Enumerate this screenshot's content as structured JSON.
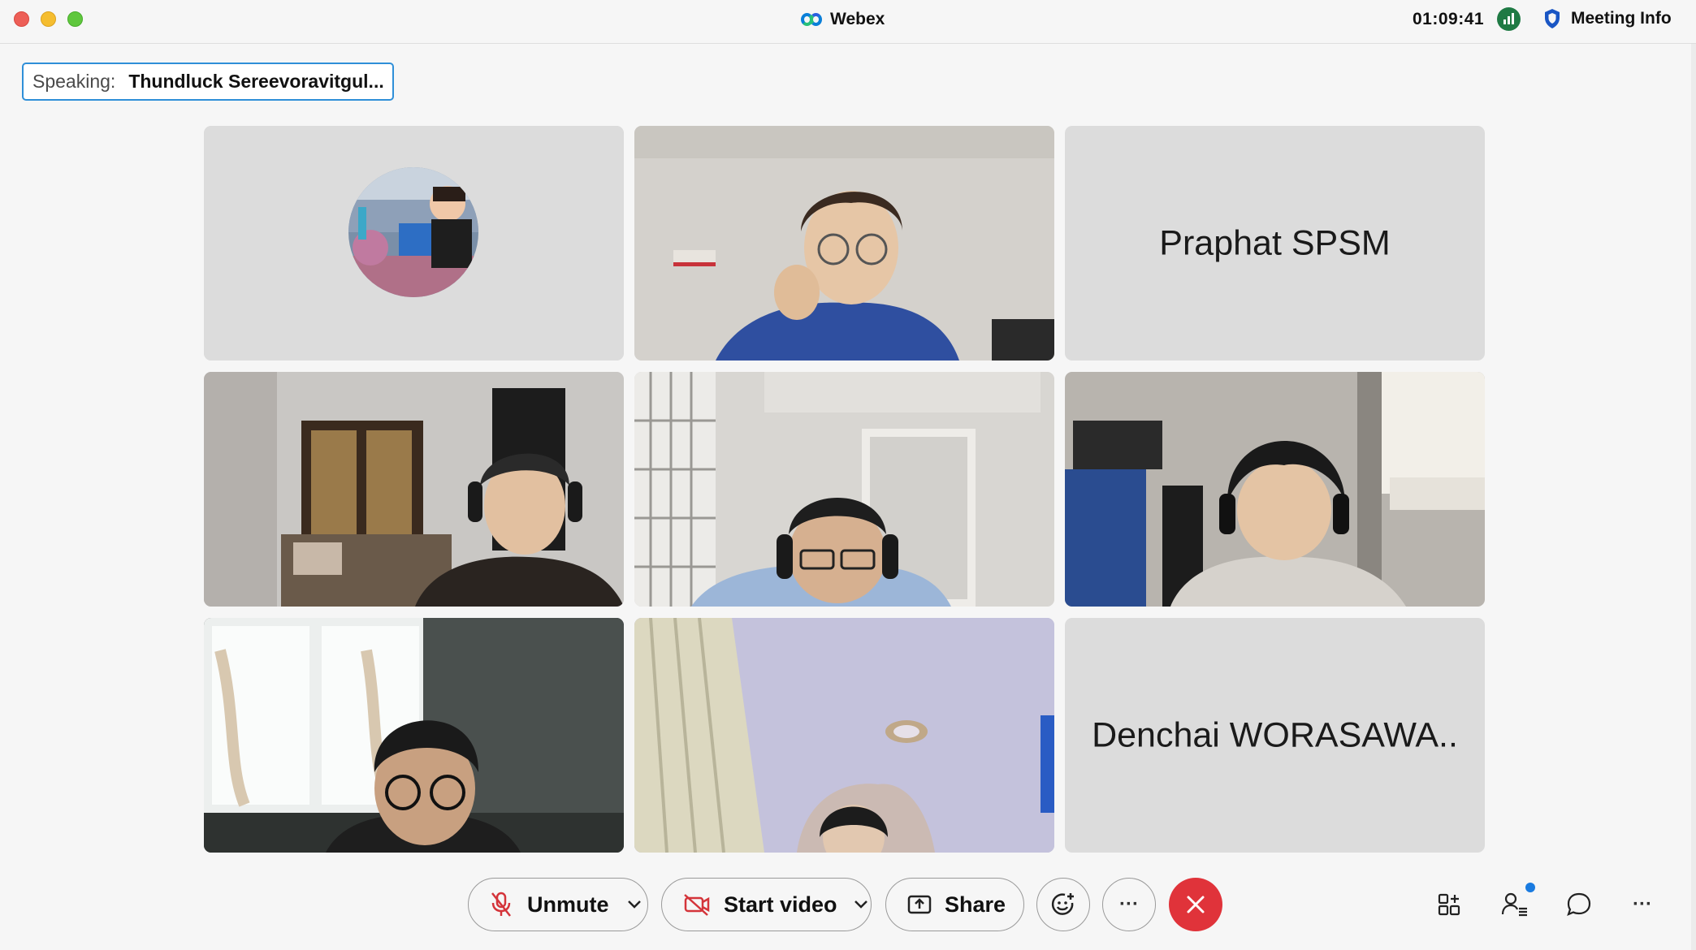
{
  "window": {
    "title": "Webex",
    "clock": "01:09:41",
    "meeting_info_label": "Meeting Info"
  },
  "speaking": {
    "label": "Speaking:",
    "name": "Thundluck Sereevoravitgul..."
  },
  "tiles": {
    "t1_kind": "avatar",
    "t2_kind": "video",
    "t3_name": "Praphat SPSM",
    "t4_kind": "video",
    "t5_kind": "video",
    "t6_kind": "video",
    "t7_kind": "video",
    "t8_kind": "video",
    "t9_name": "Denchai WORASAWA.."
  },
  "toolbar": {
    "unmute_label": "Unmute",
    "start_video_label": "Start video",
    "share_label": "Share",
    "more_glyph": "···",
    "overflow_glyph": "···"
  },
  "icons": {
    "mic": "mic-muted-icon",
    "video": "video-off-icon",
    "share": "share-screen-icon",
    "reactions": "reaction-smile-icon",
    "end": "end-call-icon",
    "layout": "layout-grid-icon",
    "participants": "participants-icon",
    "chat": "chat-icon",
    "signal": "network-signal-icon",
    "shield": "security-shield-icon"
  },
  "colors": {
    "accent": "#2f8fd8",
    "end_call": "#e0333a",
    "signal": "#1f7a44",
    "mute_red": "#d4343a"
  }
}
